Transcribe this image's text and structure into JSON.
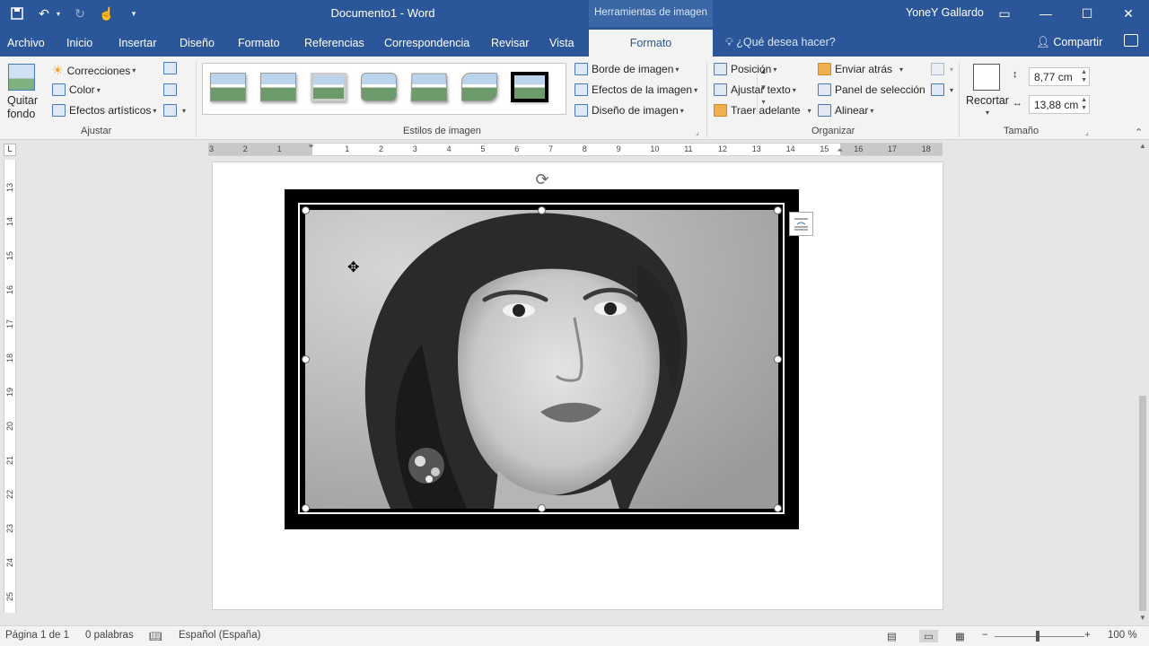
{
  "window": {
    "title": "Documento1  -  Word",
    "context_tab_group": "Herramientas de imagen",
    "user": "YoneY Gallardo"
  },
  "tabs": [
    "Archivo",
    "Inicio",
    "Insertar",
    "Diseño",
    "Formato",
    "Referencias",
    "Correspondencia",
    "Revisar",
    "Vista"
  ],
  "active_tab": "Formato",
  "tell_me": "¿Qué desea hacer?",
  "share": "Compartir",
  "ribbon": {
    "ajustar": {
      "label": "Ajustar",
      "quitar_fondo_line1": "Quitar",
      "quitar_fondo_line2": "fondo",
      "correcciones": "Correcciones",
      "color": "Color",
      "efectos_artisticos": "Efectos artísticos"
    },
    "estilos": {
      "label": "Estilos de imagen",
      "borde": "Borde de imagen",
      "efectos": "Efectos de la imagen",
      "diseno": "Diseño de imagen"
    },
    "organizar": {
      "label": "Organizar",
      "posicion": "Posición",
      "ajustar_texto": "Ajustar texto",
      "traer_adelante": "Traer adelante",
      "enviar_atras": "Enviar atrás",
      "panel_seleccion": "Panel de selección",
      "alinear": "Alinear"
    },
    "tamano": {
      "label": "Tamaño",
      "recortar": "Recortar",
      "height": "8,77 cm",
      "width": "13,88 cm"
    }
  },
  "ruler": {
    "h_numbers": [
      "3",
      "2",
      "1",
      "1",
      "2",
      "3",
      "4",
      "5",
      "6",
      "7",
      "8",
      "9",
      "10",
      "11",
      "12",
      "13",
      "14",
      "15",
      "16",
      "17",
      "18"
    ],
    "v_numbers": [
      "13",
      "14",
      "15",
      "16",
      "17",
      "18",
      "19",
      "20",
      "21",
      "22",
      "23",
      "24",
      "25"
    ],
    "corner": "L"
  },
  "status": {
    "page": "Página 1 de 1",
    "words": "0 palabras",
    "language": "Español (España)",
    "zoom": "100 %"
  },
  "colors": {
    "word_blue": "#2b579a",
    "ribbon_bg": "#f3f3f3"
  }
}
